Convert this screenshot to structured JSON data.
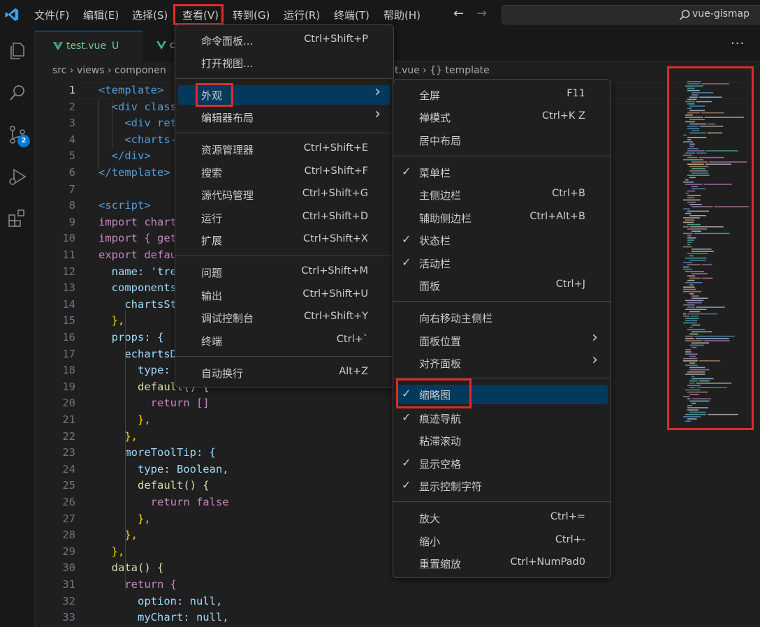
{
  "menubar": {
    "items": [
      "文件(F)",
      "编辑(E)",
      "选择(S)",
      "查看(V)",
      "转到(G)",
      "运行(R)",
      "终端(T)",
      "帮助(H)"
    ],
    "highlighted": "查看(V)"
  },
  "command_center": {
    "text": "vue-gismap"
  },
  "activity_bar": {
    "source_control_badge": "2"
  },
  "tabs": [
    {
      "label": "test.vue",
      "status": "U",
      "active": true
    },
    {
      "label": "c",
      "active": false
    }
  ],
  "breadcrumb": {
    "parts": [
      "src",
      "views",
      "componen"
    ],
    "tail": "t.vue",
    "symbol": "{} template"
  },
  "editor": {
    "lines": [
      {
        "n": "1",
        "t": "<template>"
      },
      {
        "n": "2",
        "t": "  <div class"
      },
      {
        "n": "3",
        "t": "    <div ret"
      },
      {
        "n": "4",
        "t": "    <charts-"
      },
      {
        "n": "5",
        "t": "  </div>"
      },
      {
        "n": "6",
        "t": "</template>"
      },
      {
        "n": "7",
        "t": ""
      },
      {
        "n": "8",
        "t": "<script>"
      },
      {
        "n": "9",
        "t": "import chart"
      },
      {
        "n": "10",
        "t": "import { get"
      },
      {
        "n": "11",
        "t": "export defau"
      },
      {
        "n": "12",
        "t": "  name: 'tre"
      },
      {
        "n": "13",
        "t": "  components"
      },
      {
        "n": "14",
        "t": "    chartsSt"
      },
      {
        "n": "15",
        "t": "  },"
      },
      {
        "n": "16",
        "t": "  props: {"
      },
      {
        "n": "17",
        "t": "    echartsD"
      },
      {
        "n": "18",
        "t": "      type:"
      },
      {
        "n": "19",
        "t": "      default() {"
      },
      {
        "n": "20",
        "t": "        return []"
      },
      {
        "n": "21",
        "t": "      },"
      },
      {
        "n": "22",
        "t": "    },"
      },
      {
        "n": "23",
        "t": "    moreToolTip: {"
      },
      {
        "n": "24",
        "t": "      type: Boolean,"
      },
      {
        "n": "25",
        "t": "      default() {"
      },
      {
        "n": "26",
        "t": "        return false"
      },
      {
        "n": "27",
        "t": "      },"
      },
      {
        "n": "28",
        "t": "    },"
      },
      {
        "n": "29",
        "t": "  },"
      },
      {
        "n": "30",
        "t": "  data() {"
      },
      {
        "n": "31",
        "t": "    return {"
      },
      {
        "n": "32",
        "t": "      option: null,"
      },
      {
        "n": "33",
        "t": "      myChart: null,"
      }
    ]
  },
  "view_menu": {
    "items": [
      {
        "label": "命令面板...",
        "key": "Ctrl+Shift+P"
      },
      {
        "label": "打开视图...",
        "key": ""
      },
      {
        "label": "外观",
        "key": "",
        "submenu": true,
        "active": true
      },
      {
        "label": "编辑器布局",
        "key": "",
        "submenu": true
      },
      {
        "label": "资源管理器",
        "key": "Ctrl+Shift+E"
      },
      {
        "label": "搜索",
        "key": "Ctrl+Shift+F"
      },
      {
        "label": "源代码管理",
        "key": "Ctrl+Shift+G"
      },
      {
        "label": "运行",
        "key": "Ctrl+Shift+D"
      },
      {
        "label": "扩展",
        "key": "Ctrl+Shift+X"
      },
      {
        "label": "问题",
        "key": "Ctrl+Shift+M"
      },
      {
        "label": "输出",
        "key": "Ctrl+Shift+U"
      },
      {
        "label": "调试控制台",
        "key": "Ctrl+Shift+Y"
      },
      {
        "label": "终端",
        "key": "Ctrl+`"
      },
      {
        "label": "自动换行",
        "key": "Alt+Z"
      }
    ]
  },
  "appearance_menu": {
    "items": [
      {
        "label": "全屏",
        "key": "F11",
        "checked": false
      },
      {
        "label": "禅模式",
        "key": "Ctrl+K Z",
        "checked": false
      },
      {
        "label": "居中布局",
        "key": "",
        "checked": false
      },
      {
        "label": "菜单栏",
        "key": "",
        "checked": true
      },
      {
        "label": "主侧边栏",
        "key": "Ctrl+B",
        "checked": false
      },
      {
        "label": "辅助侧边栏",
        "key": "Ctrl+Alt+B",
        "checked": false
      },
      {
        "label": "状态栏",
        "key": "",
        "checked": true
      },
      {
        "label": "活动栏",
        "key": "",
        "checked": true
      },
      {
        "label": "面板",
        "key": "Ctrl+J",
        "checked": false
      },
      {
        "label": "向右移动主侧栏",
        "key": "",
        "checked": false
      },
      {
        "label": "面板位置",
        "key": "",
        "checked": false,
        "submenu": true
      },
      {
        "label": "对齐面板",
        "key": "",
        "checked": false,
        "submenu": true
      },
      {
        "label": "缩略图",
        "key": "",
        "checked": true,
        "active": true
      },
      {
        "label": "痕迹导航",
        "key": "",
        "checked": true
      },
      {
        "label": "粘滞滚动",
        "key": "",
        "checked": false
      },
      {
        "label": "显示空格",
        "key": "",
        "checked": true
      },
      {
        "label": "显示控制字符",
        "key": "",
        "checked": true
      },
      {
        "label": "放大",
        "key": "Ctrl+=",
        "checked": false
      },
      {
        "label": "缩小",
        "key": "Ctrl+-",
        "checked": false
      },
      {
        "label": "重置缩放",
        "key": "Ctrl+NumPad0",
        "checked": false
      }
    ]
  },
  "colors": {
    "accent": "#0078d4",
    "annotation": "#e02a2a",
    "menu_active": "#04395e",
    "vue_green": "#41b883"
  }
}
